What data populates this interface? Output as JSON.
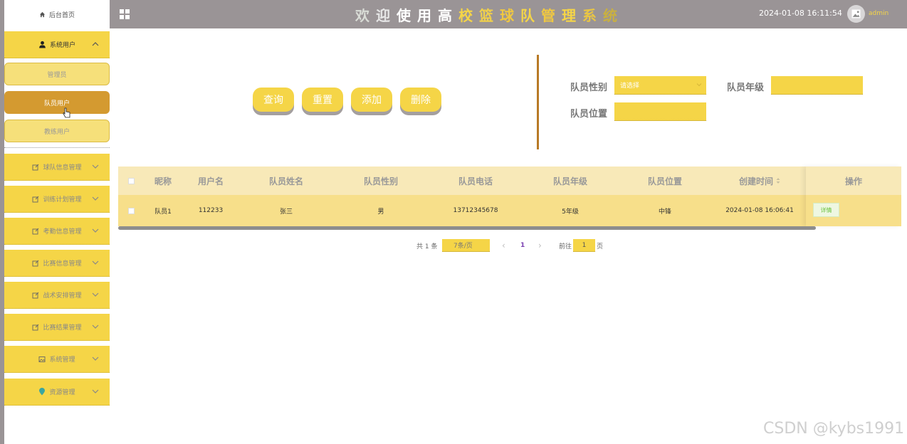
{
  "header": {
    "title_chars": [
      "欢",
      "迎",
      "使",
      "用",
      "高",
      "校",
      "篮",
      "球",
      "队",
      "管",
      "理",
      "系",
      "统"
    ],
    "title_colors": [
      "#d9dcd6",
      "#e6e6e6",
      "#ffffff",
      "#ffffff",
      "#ffffff",
      "#f5d547",
      "#f0d04a",
      "#f0c840",
      "#f5d547",
      "#f0c840",
      "#f5d547",
      "#e8c545",
      "#c9b040"
    ],
    "datetime": "2024-01-08 16:11:54",
    "username": "admin"
  },
  "sidebar": {
    "home": "后台首页",
    "system_users": "系统用户",
    "sub_items": [
      "管理员",
      "队员用户",
      "教练用户"
    ],
    "groups": [
      "球队信息管理",
      "训练计划管理",
      "考勤信息管理",
      "比赛信息管理",
      "战术安排管理",
      "比赛结果管理",
      "系统管理",
      "资源管理"
    ]
  },
  "actions": {
    "query": "查询",
    "reset": "重置",
    "add": "添加",
    "delete": "删除"
  },
  "filters": {
    "gender_label": "队员性别",
    "gender_placeholder": "请选择",
    "grade_label": "队员年级",
    "grade_value": "",
    "position_label": "队员位置",
    "position_value": ""
  },
  "table": {
    "columns": [
      "昵称",
      "用户名",
      "队员姓名",
      "队员性别",
      "队员电话",
      "队员年级",
      "队员位置",
      "创建时间"
    ],
    "ops_header": "操作",
    "rows": [
      {
        "nickname": "队员1",
        "username": "112233",
        "name": "张三",
        "gender": "男",
        "phone": "13712345678",
        "grade": "5年级",
        "position": "中锋",
        "created": "2024-01-08 16:06:41",
        "detail": "详情"
      }
    ]
  },
  "pagination": {
    "total": "共 1 条",
    "page_size": "7条/页",
    "prev": "‹",
    "current_page": "1",
    "next": "›",
    "goto_label": "前往",
    "goto_value": "1",
    "page_suffix": "页"
  },
  "watermark": "CSDN @kybs1991"
}
